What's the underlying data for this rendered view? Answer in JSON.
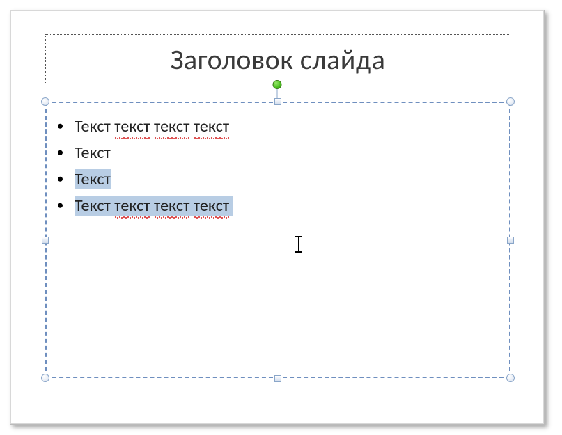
{
  "title": {
    "text": "Заголовок слайда"
  },
  "bullets": [
    {
      "plain": "Текст ",
      "words": [
        "текст",
        "текст",
        "текст"
      ]
    },
    {
      "plain": "Текст"
    },
    {
      "plain_sel": "Текст"
    },
    {
      "plain_sel_start": "Текст ",
      "words_sel": [
        "текст",
        "текст",
        "текст"
      ]
    }
  ]
}
